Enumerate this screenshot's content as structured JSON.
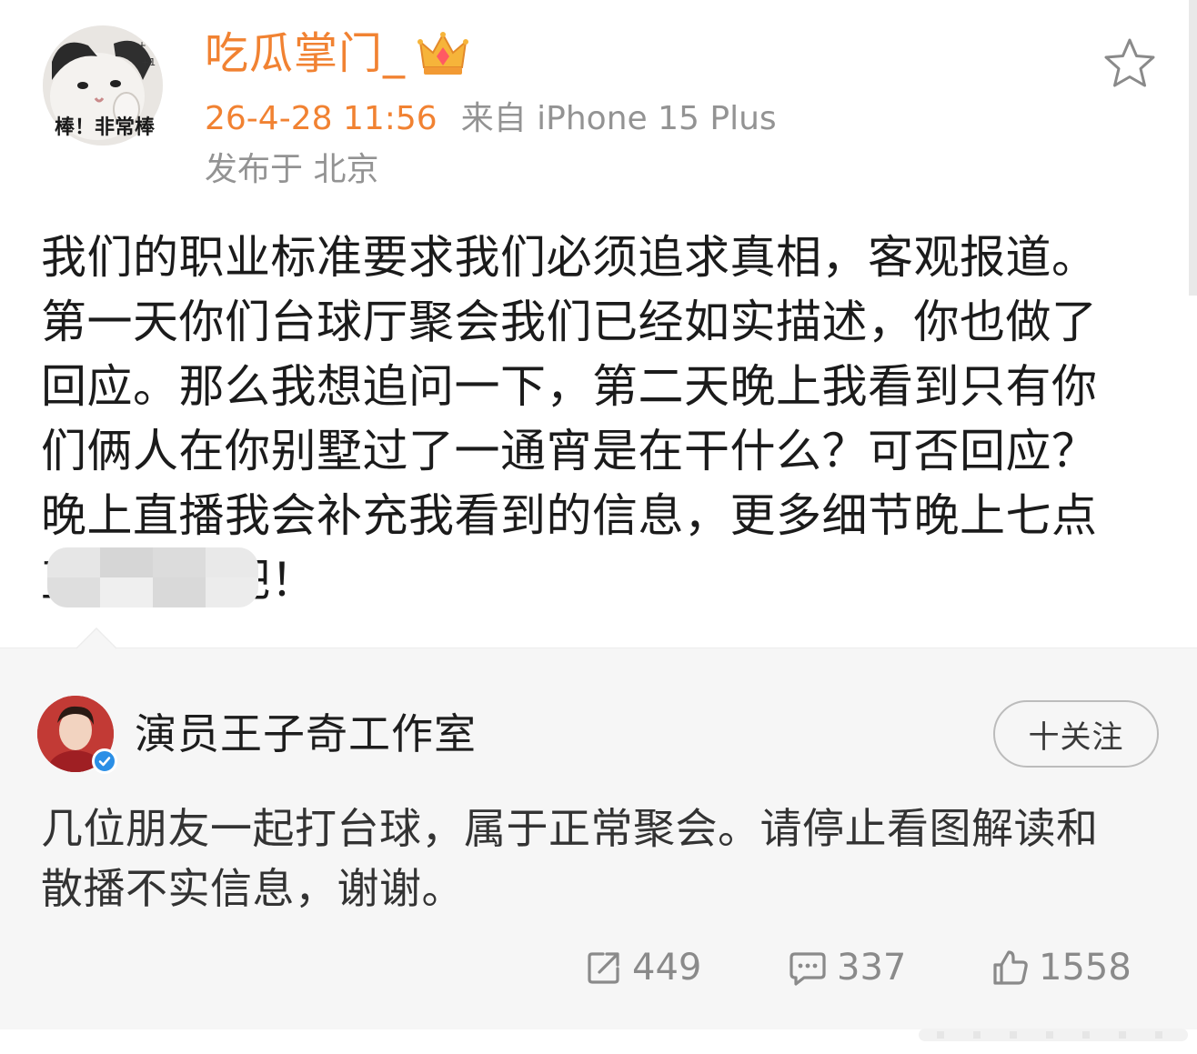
{
  "post": {
    "author": {
      "name": "吃瓜掌门_",
      "avatar_icon": "cat-avatar",
      "badge_icon": "crown-icon",
      "avatar_caption": "棒！非常棒"
    },
    "timestamp": "26-4-28 11:56",
    "source": "来自 iPhone 15 Plus",
    "location": "发布于 北京",
    "body_lines": [
      "我们的职业标准要求我们必须追求真相，客观报道。",
      "第一天你们台球厅聚会我们已经如实描述，你也做了",
      "回应。那么我想追问一下，第二天晚上我看到只有你",
      "们俩人在你别墅过了一通宵是在干什么？可否回应？",
      "晚上直播我会补充我看到的信息，更多细节晚上七点",
      "直播间聊吧！"
    ],
    "last_line_visible_tail": "间聊吧！",
    "star_icon": "star-outline-icon"
  },
  "quoted": {
    "author": {
      "name": "演员王子奇工作室",
      "verified_icon": "verified-check-icon"
    },
    "follow_label": "十关注",
    "body": "几位朋友一起打台球，属于正常聚会。请停止看图解读和散播不实信息，谢谢。",
    "body_lines": [
      "几位朋友一起打台球，属于正常聚会。请停止看图解读和",
      "散播不实信息，谢谢。"
    ],
    "stats": {
      "reposts": "449",
      "comments": "337",
      "likes": "1558"
    }
  },
  "colors": {
    "username": "#f18232",
    "meta_grey": "#939393",
    "body_text": "#1b1b1b",
    "quote_bg": "#f6f6f6",
    "verified_blue": "#2b8fe6"
  }
}
